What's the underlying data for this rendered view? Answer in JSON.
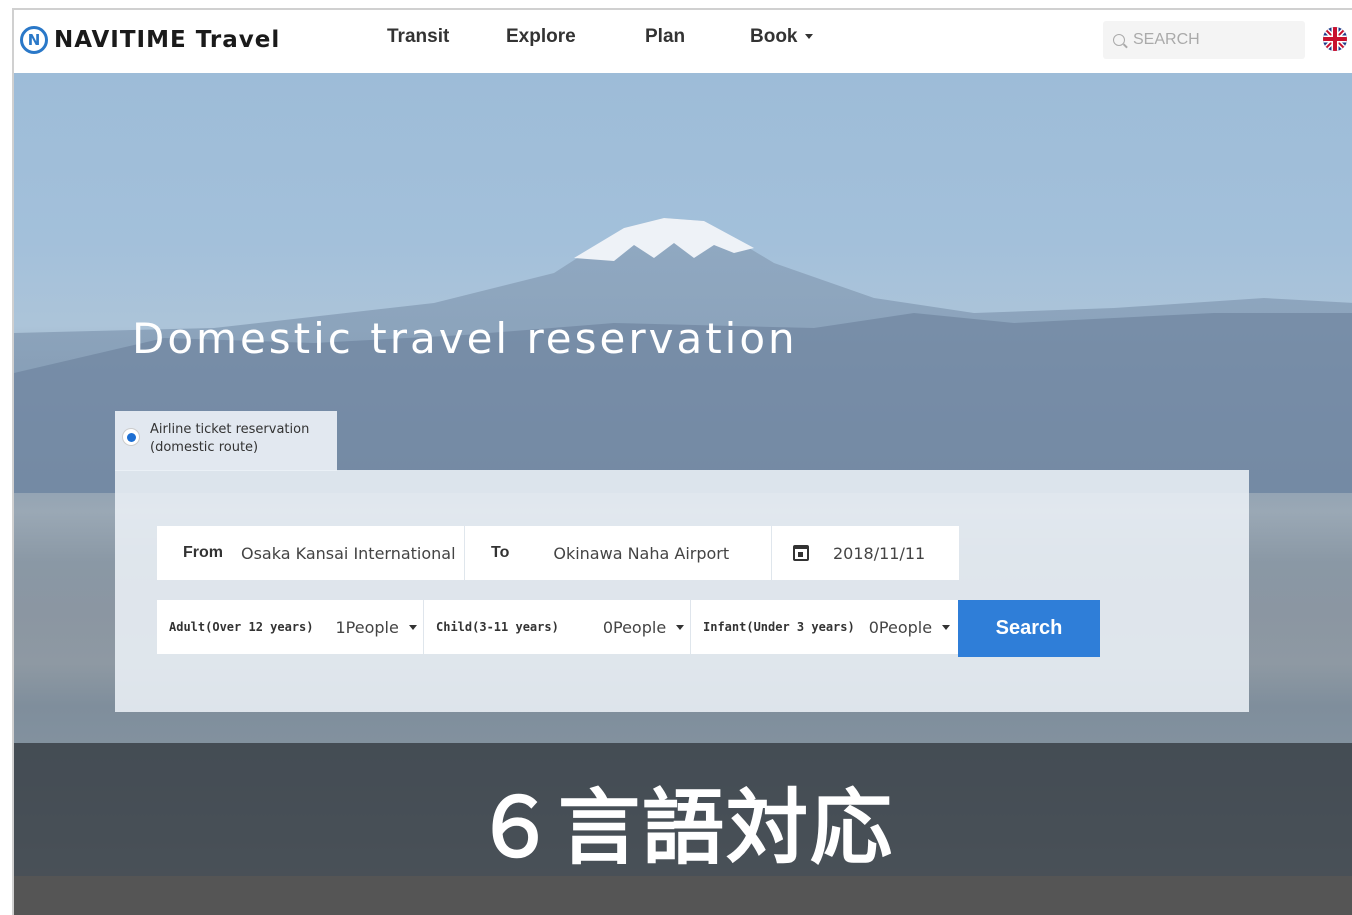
{
  "header": {
    "logo_text": "NAVITIME Travel",
    "logo_mark": "N",
    "nav": [
      {
        "label": "Transit"
      },
      {
        "label": "Explore"
      },
      {
        "label": "Plan"
      },
      {
        "label": "Book"
      }
    ],
    "search_placeholder": "SEARCH",
    "language_icon": "uk-flag-icon"
  },
  "hero": {
    "title": "Domestic travel reservation"
  },
  "form": {
    "tab_label_line1": "Airline ticket reservation",
    "tab_label_line2": "(domestic route)",
    "from_label": "From",
    "from_value": "Osaka Kansai International",
    "to_label": "To",
    "to_value": "Okinawa Naha Airport",
    "date_value": "2018/11/11",
    "adult_label": "Adult(Over 12 years)",
    "adult_value": "1People",
    "child_label": "Child(3-11 years)",
    "child_value": "0People",
    "infant_label": "Infant(Under 3 years)",
    "infant_value": "0People",
    "search_button": "Search"
  },
  "banner": {
    "text": "６言語対応"
  },
  "colors": {
    "accent": "#2f7ed8",
    "logo": "#2a78c8"
  }
}
